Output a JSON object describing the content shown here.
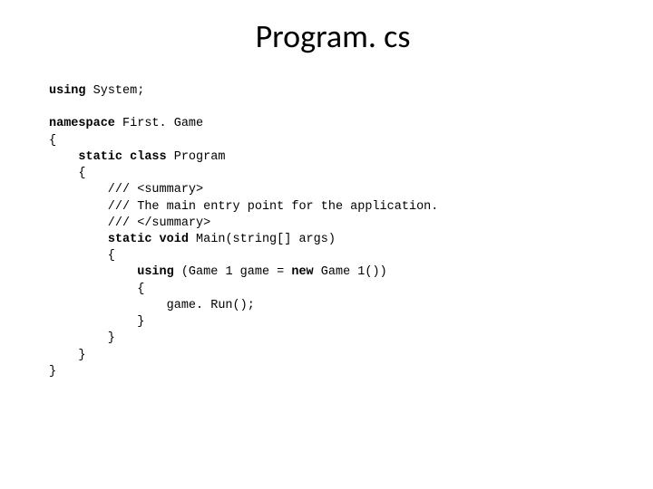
{
  "title": "Program. cs",
  "code": {
    "l1_kw": "using",
    "l1_rest": " System;",
    "l3_kw": "namespace",
    "l3_rest": " First. Game",
    "l4": "{",
    "l5_ind": "    ",
    "l5_kw": "static class",
    "l5_rest": " Program",
    "l6": "    {",
    "l7": "        /// <summary>",
    "l8": "        /// The main entry point for the application.",
    "l9": "        /// </summary>",
    "l10_ind": "        ",
    "l10_kw": "static void",
    "l10_rest": " Main(string[] args)",
    "l11": "        {",
    "l12_ind": "            ",
    "l12_kw": "using",
    "l12_rest1": " (Game 1 game = ",
    "l12_kw2": "new",
    "l12_rest2": " Game 1())",
    "l13": "            {",
    "l14": "                game. Run();",
    "l15": "            }",
    "l16": "        }",
    "l17": "    }",
    "l18": "}"
  }
}
